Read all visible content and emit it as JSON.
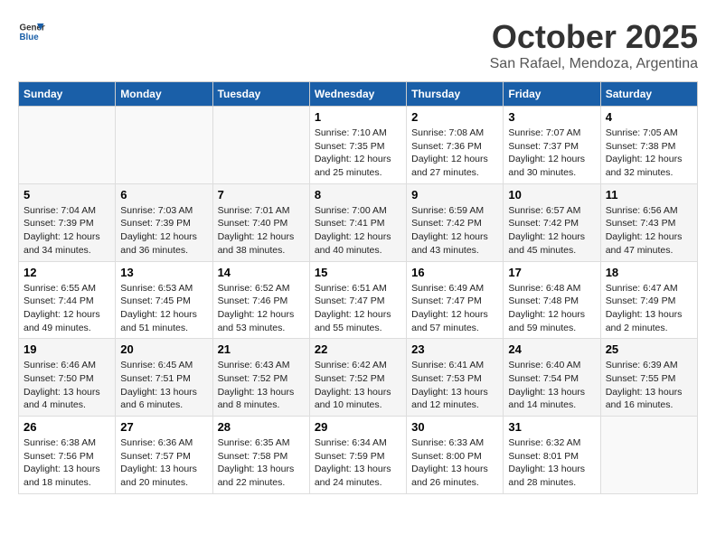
{
  "header": {
    "logo_line1": "General",
    "logo_line2": "Blue",
    "month": "October 2025",
    "location": "San Rafael, Mendoza, Argentina"
  },
  "weekdays": [
    "Sunday",
    "Monday",
    "Tuesday",
    "Wednesday",
    "Thursday",
    "Friday",
    "Saturday"
  ],
  "weeks": [
    [
      {
        "day": "",
        "info": ""
      },
      {
        "day": "",
        "info": ""
      },
      {
        "day": "",
        "info": ""
      },
      {
        "day": "1",
        "info": "Sunrise: 7:10 AM\nSunset: 7:35 PM\nDaylight: 12 hours\nand 25 minutes."
      },
      {
        "day": "2",
        "info": "Sunrise: 7:08 AM\nSunset: 7:36 PM\nDaylight: 12 hours\nand 27 minutes."
      },
      {
        "day": "3",
        "info": "Sunrise: 7:07 AM\nSunset: 7:37 PM\nDaylight: 12 hours\nand 30 minutes."
      },
      {
        "day": "4",
        "info": "Sunrise: 7:05 AM\nSunset: 7:38 PM\nDaylight: 12 hours\nand 32 minutes."
      }
    ],
    [
      {
        "day": "5",
        "info": "Sunrise: 7:04 AM\nSunset: 7:39 PM\nDaylight: 12 hours\nand 34 minutes."
      },
      {
        "day": "6",
        "info": "Sunrise: 7:03 AM\nSunset: 7:39 PM\nDaylight: 12 hours\nand 36 minutes."
      },
      {
        "day": "7",
        "info": "Sunrise: 7:01 AM\nSunset: 7:40 PM\nDaylight: 12 hours\nand 38 minutes."
      },
      {
        "day": "8",
        "info": "Sunrise: 7:00 AM\nSunset: 7:41 PM\nDaylight: 12 hours\nand 40 minutes."
      },
      {
        "day": "9",
        "info": "Sunrise: 6:59 AM\nSunset: 7:42 PM\nDaylight: 12 hours\nand 43 minutes."
      },
      {
        "day": "10",
        "info": "Sunrise: 6:57 AM\nSunset: 7:42 PM\nDaylight: 12 hours\nand 45 minutes."
      },
      {
        "day": "11",
        "info": "Sunrise: 6:56 AM\nSunset: 7:43 PM\nDaylight: 12 hours\nand 47 minutes."
      }
    ],
    [
      {
        "day": "12",
        "info": "Sunrise: 6:55 AM\nSunset: 7:44 PM\nDaylight: 12 hours\nand 49 minutes."
      },
      {
        "day": "13",
        "info": "Sunrise: 6:53 AM\nSunset: 7:45 PM\nDaylight: 12 hours\nand 51 minutes."
      },
      {
        "day": "14",
        "info": "Sunrise: 6:52 AM\nSunset: 7:46 PM\nDaylight: 12 hours\nand 53 minutes."
      },
      {
        "day": "15",
        "info": "Sunrise: 6:51 AM\nSunset: 7:47 PM\nDaylight: 12 hours\nand 55 minutes."
      },
      {
        "day": "16",
        "info": "Sunrise: 6:49 AM\nSunset: 7:47 PM\nDaylight: 12 hours\nand 57 minutes."
      },
      {
        "day": "17",
        "info": "Sunrise: 6:48 AM\nSunset: 7:48 PM\nDaylight: 12 hours\nand 59 minutes."
      },
      {
        "day": "18",
        "info": "Sunrise: 6:47 AM\nSunset: 7:49 PM\nDaylight: 13 hours\nand 2 minutes."
      }
    ],
    [
      {
        "day": "19",
        "info": "Sunrise: 6:46 AM\nSunset: 7:50 PM\nDaylight: 13 hours\nand 4 minutes."
      },
      {
        "day": "20",
        "info": "Sunrise: 6:45 AM\nSunset: 7:51 PM\nDaylight: 13 hours\nand 6 minutes."
      },
      {
        "day": "21",
        "info": "Sunrise: 6:43 AM\nSunset: 7:52 PM\nDaylight: 13 hours\nand 8 minutes."
      },
      {
        "day": "22",
        "info": "Sunrise: 6:42 AM\nSunset: 7:52 PM\nDaylight: 13 hours\nand 10 minutes."
      },
      {
        "day": "23",
        "info": "Sunrise: 6:41 AM\nSunset: 7:53 PM\nDaylight: 13 hours\nand 12 minutes."
      },
      {
        "day": "24",
        "info": "Sunrise: 6:40 AM\nSunset: 7:54 PM\nDaylight: 13 hours\nand 14 minutes."
      },
      {
        "day": "25",
        "info": "Sunrise: 6:39 AM\nSunset: 7:55 PM\nDaylight: 13 hours\nand 16 minutes."
      }
    ],
    [
      {
        "day": "26",
        "info": "Sunrise: 6:38 AM\nSunset: 7:56 PM\nDaylight: 13 hours\nand 18 minutes."
      },
      {
        "day": "27",
        "info": "Sunrise: 6:36 AM\nSunset: 7:57 PM\nDaylight: 13 hours\nand 20 minutes."
      },
      {
        "day": "28",
        "info": "Sunrise: 6:35 AM\nSunset: 7:58 PM\nDaylight: 13 hours\nand 22 minutes."
      },
      {
        "day": "29",
        "info": "Sunrise: 6:34 AM\nSunset: 7:59 PM\nDaylight: 13 hours\nand 24 minutes."
      },
      {
        "day": "30",
        "info": "Sunrise: 6:33 AM\nSunset: 8:00 PM\nDaylight: 13 hours\nand 26 minutes."
      },
      {
        "day": "31",
        "info": "Sunrise: 6:32 AM\nSunset: 8:01 PM\nDaylight: 13 hours\nand 28 minutes."
      },
      {
        "day": "",
        "info": ""
      }
    ]
  ]
}
